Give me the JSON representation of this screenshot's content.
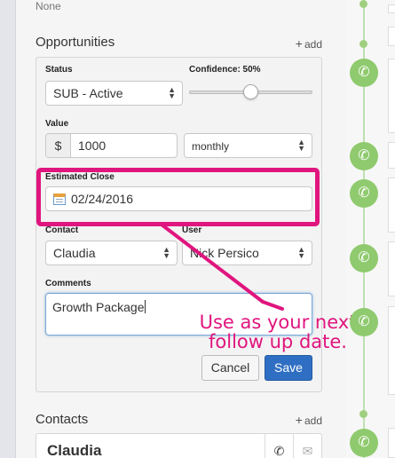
{
  "top": {
    "none_text": "None"
  },
  "opportunities": {
    "title": "Opportunities",
    "add_label": "add",
    "status_label": "Status",
    "status_value": "SUB - Active",
    "confidence_label": "Confidence: 50%",
    "confidence_value": 0.5,
    "value_label": "Value",
    "currency_symbol": "$",
    "value": "1000",
    "frequency": "monthly",
    "estimated_close_label": "Estimated Close",
    "estimated_close_value": "02/24/2016",
    "contact_label": "Contact",
    "contact_value": "Claudia",
    "user_label": "User",
    "user_value": "Nick Persico",
    "comments_label": "Comments",
    "comments_value": "Growth Package",
    "cancel_label": "Cancel",
    "save_label": "Save"
  },
  "annotation": {
    "callout_text": "Use as your next follow up date.",
    "color": "#e0157e"
  },
  "contacts": {
    "title": "Contacts",
    "add_label": "add",
    "items": [
      {
        "name": "Claudia"
      }
    ]
  },
  "colors": {
    "accent_blue": "#2f6fc3",
    "timeline_green": "#8fca6e",
    "highlight_pink": "#e0157e"
  },
  "icons": {
    "phone": "phone-icon",
    "mail": "mail-icon",
    "calendar": "calendar-icon"
  }
}
